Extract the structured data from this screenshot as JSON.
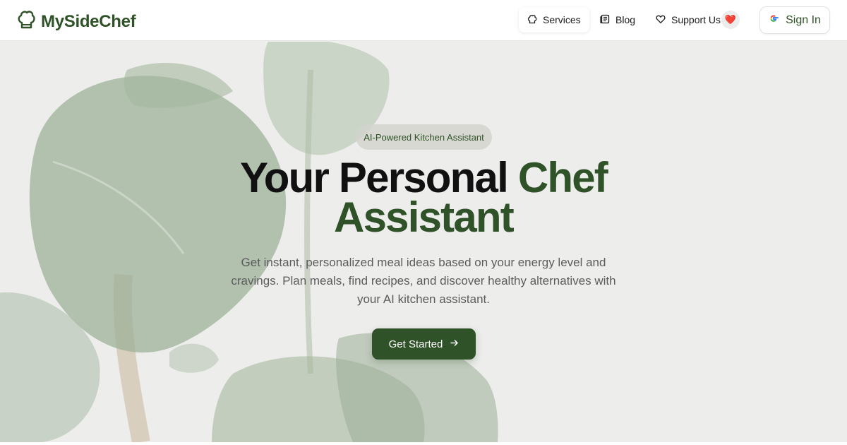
{
  "header": {
    "brand": "MySideChef",
    "nav": {
      "services": "Services",
      "blog": "Blog",
      "support": "Support Us"
    },
    "heart_emoji": "❤️",
    "sign_in": "Sign In",
    "icons": [
      "chef-hat-icon",
      "chef-hat-small-icon",
      "newspaper-icon",
      "heart-outline-icon",
      "google-icon",
      "arrow-right-icon"
    ]
  },
  "hero": {
    "badge": "AI-Powered Kitchen Assistant",
    "title_part1": "Your Personal ",
    "title_accent": "Chef Assistant",
    "subtitle": "Get instant, personalized meal ideas based on your energy level and cravings. Plan meals, find recipes, and discover healthy alternatives with your AI kitchen assistant.",
    "cta": "Get Started"
  },
  "colors": {
    "brand_green": "#2f5228",
    "hero_background": "#ededeb",
    "heart_red": "#d8263b"
  }
}
